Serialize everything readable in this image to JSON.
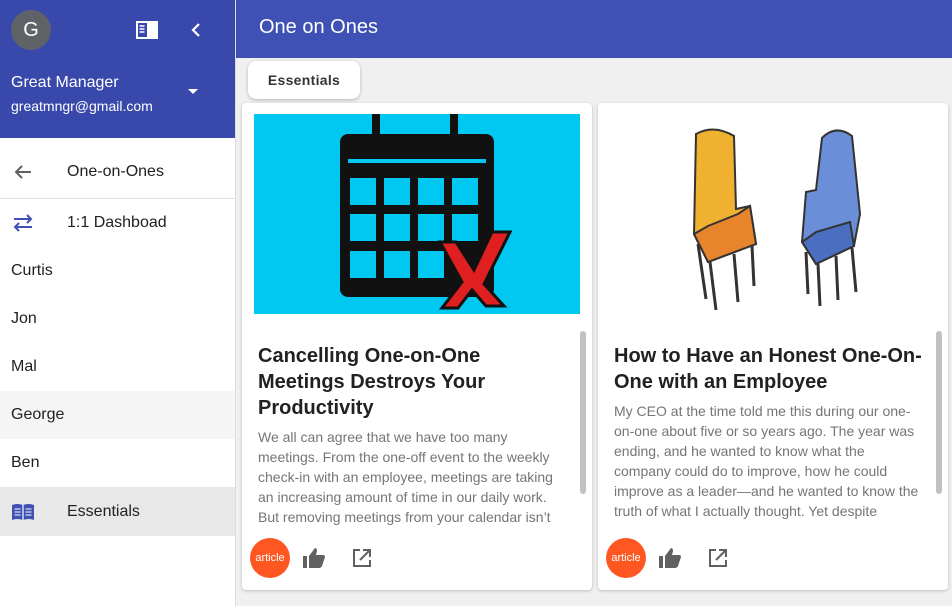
{
  "sidebar": {
    "avatar_letter": "G",
    "user_name": "Great Manager",
    "user_email": "greatmngr@gmail.com",
    "back_label": "One-on-Ones",
    "dashboard_label": "1:1 Dashboad",
    "people": [
      "Curtis",
      "Jon",
      "Mal",
      "George",
      "Ben"
    ],
    "selected_person": "George",
    "essentials_label": "Essentials",
    "header_color": "#3949ab"
  },
  "appbar": {
    "title": "One on Ones",
    "color": "#3f51b5"
  },
  "tabs": {
    "active": "Essentials"
  },
  "cards": [
    {
      "image_icon": "calendar-cancel-icon",
      "title": "Cancelling One-on-One Meetings Destroys Your Productivity",
      "text": "We all can agree that we have too many meetings. From the one-off event to the weekly check-in with an employee, meetings are taking an increasing amount of time in our daily work. But removing meetings from your calendar isn’t",
      "badge": "article"
    },
    {
      "image_icon": "two-chairs-icon",
      "title": "How to Have an Honest One-On-One with an Employee",
      "text": "My CEO at the time told me this during our one-on-one about five or so years ago. The year was ending, and he wanted to know what the company could do to improve, how he could improve as a leader—and he wanted to know the truth of what I actually thought. Yet despite",
      "badge": "article"
    }
  ],
  "colors": {
    "badge": "#ff5722",
    "accent_icon": "#3f51b5"
  }
}
